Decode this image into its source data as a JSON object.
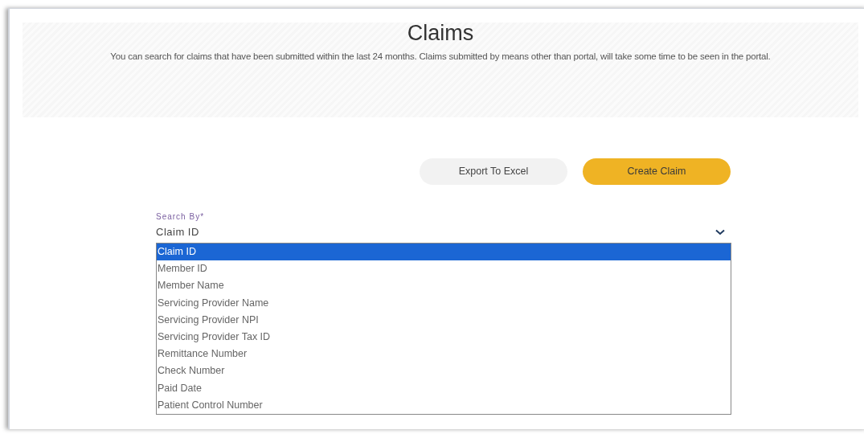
{
  "header": {
    "title": "Claims",
    "description": "You can search for claims that have been submitted within the last 24 months. Claims submitted by means other than portal, will take some time to be seen in the portal."
  },
  "buttons": [
    {
      "label": "Export To Excel",
      "kind": "secondary"
    },
    {
      "label": "Create Claim",
      "kind": "primary"
    }
  ],
  "search_by": {
    "label": "Search By*",
    "value": "Claim ID",
    "expanded": true,
    "options": [
      {
        "label": "Claim ID",
        "selected": true
      },
      {
        "label": "Member ID",
        "selected": false
      },
      {
        "label": "Member Name",
        "selected": false
      },
      {
        "label": "Servicing Provider Name",
        "selected": false
      },
      {
        "label": "Servicing Provider NPI",
        "selected": false
      },
      {
        "label": "Servicing Provider Tax ID",
        "selected": false
      },
      {
        "label": "Remittance Number",
        "selected": false
      },
      {
        "label": "Check Number",
        "selected": false
      },
      {
        "label": "Paid Date",
        "selected": false
      },
      {
        "label": "Patient Control Number",
        "selected": false
      }
    ]
  }
}
